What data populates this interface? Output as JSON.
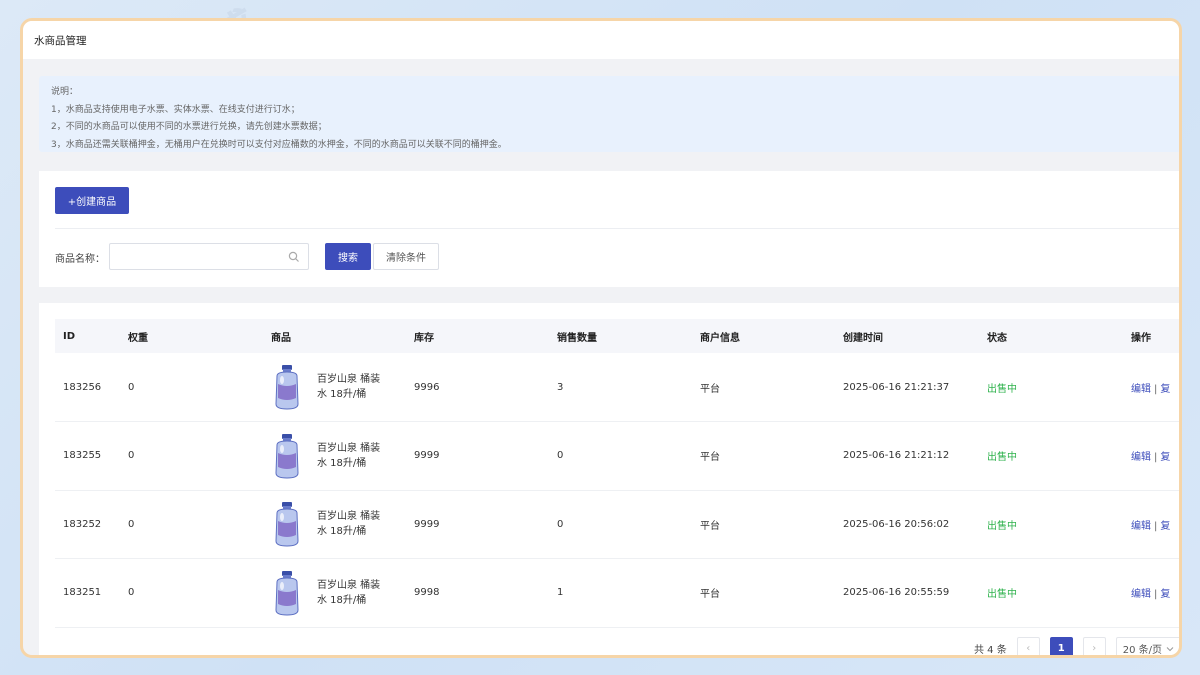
{
  "header": {
    "title": "水商品管理"
  },
  "notice": {
    "lines": [
      "说明：",
      "1，水商品支持使用电子水票、实体水票、在线支付进行订水；",
      "2，不同的水商品可以使用不同的水票进行兑换，请先创建水票数据；",
      "3，水商品还需关联桶押金，无桶用户在兑换时可以支付对应桶数的水押金，不同的水商品可以关联不同的桶押金。"
    ]
  },
  "toolbar": {
    "create_label": "+创建商品",
    "search_label": "商品名称：",
    "search_value": "",
    "search_button": "搜索",
    "clear_button": "清除条件"
  },
  "table": {
    "headers": {
      "id": "ID",
      "weight": "权重",
      "product": "商品",
      "stock": "库存",
      "sold": "销售数量",
      "merchant": "商户信息",
      "created": "创建时间",
      "status": "状态",
      "ops": "操作"
    },
    "rows": [
      {
        "id": "183256",
        "weight": "0",
        "product": "百岁山泉 桶装水 18升/桶",
        "stock": "9996",
        "sold": "3",
        "merchant": "平台",
        "created": "2025-06-16 21:21:37",
        "status": "出售中",
        "edit": "编辑",
        "copy": "复"
      },
      {
        "id": "183255",
        "weight": "0",
        "product": "百岁山泉 桶装水 18升/桶",
        "stock": "9999",
        "sold": "0",
        "merchant": "平台",
        "created": "2025-06-16 21:21:12",
        "status": "出售中",
        "edit": "编辑",
        "copy": "复"
      },
      {
        "id": "183252",
        "weight": "0",
        "product": "百岁山泉 桶装水 18升/桶",
        "stock": "9999",
        "sold": "0",
        "merchant": "平台",
        "created": "2025-06-16 20:56:02",
        "status": "出售中",
        "edit": "编辑",
        "copy": "复"
      },
      {
        "id": "183251",
        "weight": "0",
        "product": "百岁山泉 桶装水 18升/桶",
        "stock": "9998",
        "sold": "1",
        "merchant": "平台",
        "created": "2025-06-16 20:55:59",
        "status": "出售中",
        "edit": "编辑",
        "copy": "复"
      }
    ]
  },
  "pagination": {
    "total": "共 4 条",
    "prev": "‹",
    "current": "1",
    "next": "›",
    "page_size": "20 条/页"
  },
  "watermark": {
    "text": "编界感"
  },
  "colors": {
    "primary": "#3d4dbb",
    "status_on": "#2eb24c",
    "frame_border": "#f6d5a8"
  }
}
